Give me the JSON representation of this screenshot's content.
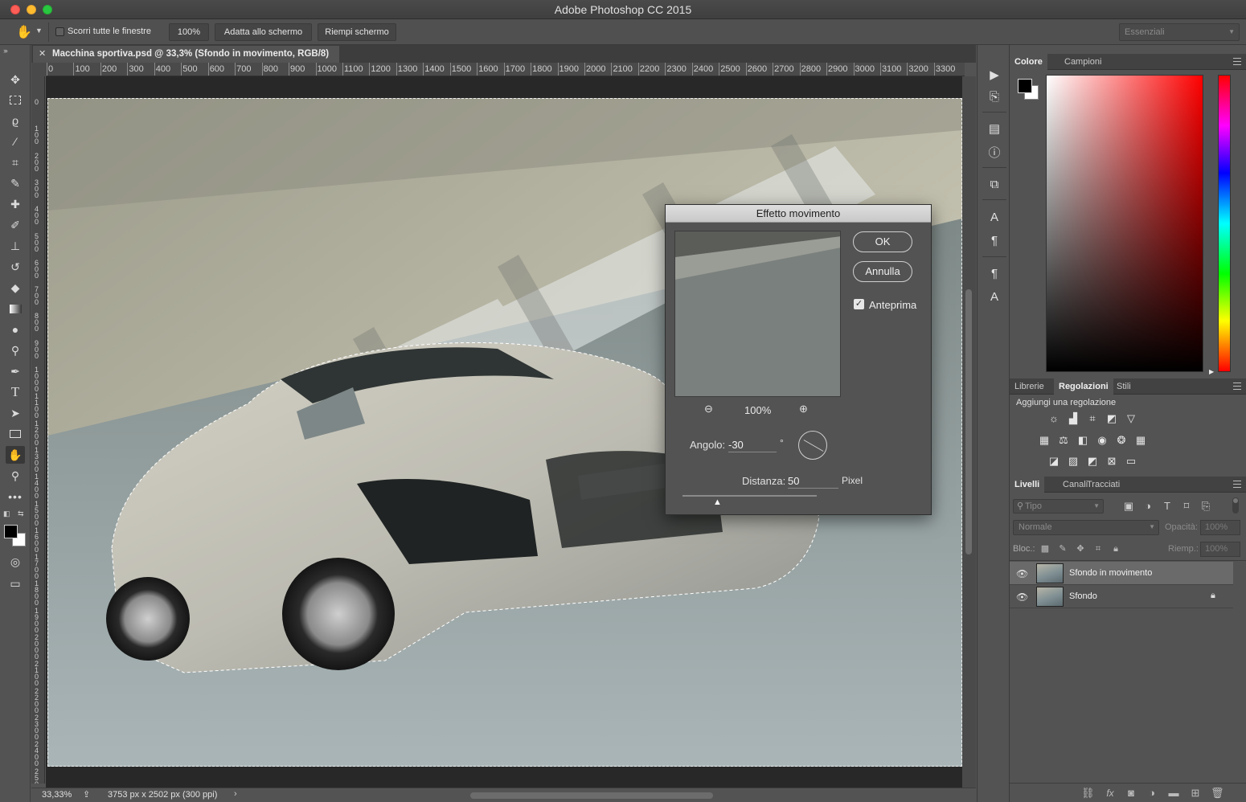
{
  "app": {
    "title": "Adobe Photoshop CC 2015"
  },
  "options_bar": {
    "scroll_all_label": "Scorri tutte le finestre",
    "zoom_btn": "100%",
    "fit_screen_btn": "Adatta allo schermo",
    "fill_screen_btn": "Riempi schermo",
    "workspace": "Essenziali"
  },
  "document": {
    "tab_title": "Macchina sportiva.psd @ 33,3% (Sfondo in movimento, RGB/8)",
    "zoom": "33,33%",
    "size_info": "3753 px x 2502 px (300 ppi)"
  },
  "ruler": {
    "h_ticks": [
      "0",
      "100",
      "200",
      "300",
      "400",
      "500",
      "600",
      "700",
      "800",
      "900",
      "1000",
      "1100",
      "1200",
      "1300",
      "1400",
      "1500",
      "1600",
      "1700",
      "1800",
      "1900",
      "2000",
      "2100",
      "2200",
      "2300",
      "2400",
      "2500",
      "2600",
      "2700",
      "2800",
      "2900",
      "3000",
      "3100",
      "3200",
      "3300"
    ],
    "v_ticks": [
      "0",
      "1 0 0",
      "2 0 0",
      "3 0 0",
      "4 0 0",
      "5 0 0",
      "6 0 0",
      "7 0 0",
      "8 0 0",
      "9 0 0",
      "1 0 0 0",
      "1 1 0 0",
      "1 2 0 0",
      "1 3 0 0",
      "1 4 0 0",
      "1 5 0 0",
      "1 6 0 0",
      "1 7 0 0",
      "1 8 0 0",
      "1 9 0 0",
      "2 0 0 0",
      "2 1 0 0",
      "2 2 0 0",
      "2 3 0 0",
      "2 4 0 0",
      "2 5 0 0"
    ]
  },
  "dialog": {
    "title": "Effetto movimento",
    "ok": "OK",
    "cancel": "Annulla",
    "preview_label": "Anteprima",
    "preview_checked": true,
    "zoom": "100%",
    "angle_label": "Angolo:",
    "angle_value": "-30",
    "angle_unit": "°",
    "distance_label": "Distanza:",
    "distance_value": "50",
    "distance_unit": "Pixel"
  },
  "color_panel": {
    "tabs": [
      "Colore",
      "Campioni"
    ],
    "foreground": "#000000",
    "background": "#ffffff"
  },
  "adjust_panel": {
    "tabs": [
      "Librerie",
      "Regolazioni",
      "Stili"
    ],
    "heading": "Aggiungi una regolazione"
  },
  "layers_panel": {
    "tabs": [
      "Livelli",
      "Canali",
      "Tracciati"
    ],
    "filter_placeholder": "Tipo",
    "blend_mode": "Normale",
    "opacity_label": "Opacità:",
    "opacity_value": "100%",
    "lock_label": "Bloc.:",
    "fill_label": "Riemp.:",
    "fill_value": "100%",
    "layers": [
      {
        "name": "Sfondo in movimento",
        "selected": true,
        "locked": false
      },
      {
        "name": "Sfondo",
        "selected": false,
        "locked": true
      }
    ]
  }
}
